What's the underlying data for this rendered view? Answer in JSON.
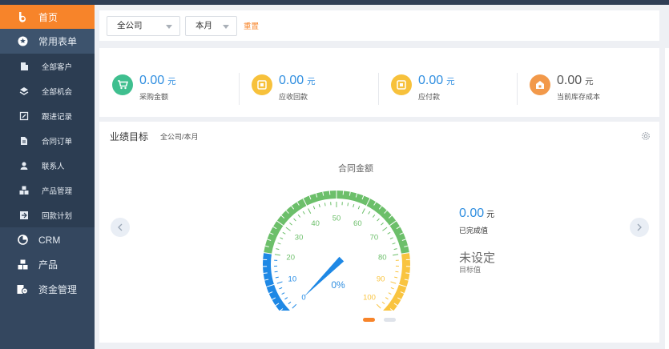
{
  "sidebar": {
    "home": "首页",
    "common_forms": "常用表单",
    "sub_items": [
      {
        "label": "全部客户",
        "icon": "building-icon"
      },
      {
        "label": "全部机会",
        "icon": "opportunity-icon"
      },
      {
        "label": "跟进记录",
        "icon": "note-icon"
      },
      {
        "label": "合同订单",
        "icon": "document-icon"
      },
      {
        "label": "联系人",
        "icon": "contact-icon"
      },
      {
        "label": "产品管理",
        "icon": "product-icon"
      },
      {
        "label": "回款计划",
        "icon": "payment-icon"
      }
    ],
    "crm": "CRM",
    "product": "产品",
    "finance": "资金管理"
  },
  "filter": {
    "company": "全公司",
    "period": "本月",
    "reset": "重置"
  },
  "stats": [
    {
      "value": "0.00",
      "unit": "元",
      "label": "采购金额",
      "color": "#3fbf8f",
      "icon": "cart-icon"
    },
    {
      "value": "0.00",
      "unit": "元",
      "label": "应收回款",
      "color": "#f7c13b",
      "icon": "receivable-icon"
    },
    {
      "value": "0.00",
      "unit": "元",
      "label": "应付款",
      "color": "#f7c13b",
      "icon": "payable-icon"
    },
    {
      "value": "0.00",
      "unit": "元",
      "label": "当前库存成本",
      "color": "#f2994a",
      "icon": "inventory-icon"
    }
  ],
  "performance": {
    "title": "业绩目标",
    "scope": "全公司/本月",
    "gauge_title": "合同金额",
    "percent_text": "0%",
    "completed_value": "0.00",
    "completed_unit": "元",
    "completed_label": "已完成值",
    "target_value": "未设定",
    "target_label": "目标值",
    "gauge": {
      "min": 0,
      "max": 100,
      "value": 0,
      "ticks": [
        "0",
        "10",
        "20",
        "30",
        "40",
        "50",
        "60",
        "70",
        "80",
        "90",
        "100"
      ],
      "colors": {
        "low": "#1e88e5",
        "mid": "#6cbf6a",
        "high": "#f9c440"
      }
    },
    "pager": {
      "active": 0,
      "count": 2
    }
  }
}
